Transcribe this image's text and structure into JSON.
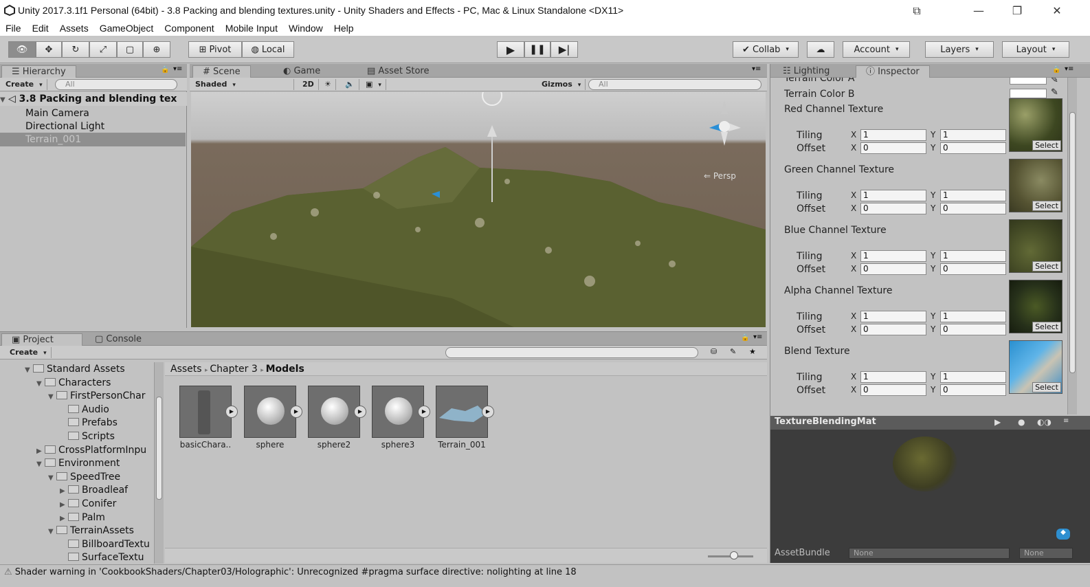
{
  "window": {
    "title": "Unity 2017.3.1f1 Personal (64bit) - 3.8 Packing and blending textures.unity - Unity Shaders and Effects - PC, Mac & Linux Standalone <DX11>"
  },
  "menu": [
    "File",
    "Edit",
    "Assets",
    "GameObject",
    "Component",
    "Mobile Input",
    "Window",
    "Help"
  ],
  "toolbar": {
    "pivot": "Pivot",
    "local": "Local",
    "collab": "Collab",
    "account": "Account",
    "layers": "Layers",
    "layout": "Layout"
  },
  "hierarchy": {
    "tab": "Hierarchy",
    "create": "Create",
    "search_placeholder": "All",
    "scene": "3.8 Packing and blending tex",
    "items": [
      "Main Camera",
      "Directional Light",
      "Terrain_001"
    ]
  },
  "scene": {
    "tabs": [
      "Scene",
      "Game",
      "Asset Store"
    ],
    "shading": "Shaded",
    "mode2d": "2D",
    "gizmos": "Gizmos",
    "search_placeholder": "All",
    "persp": "Persp"
  },
  "inspector": {
    "tabs": [
      "Lighting",
      "Inspector"
    ],
    "color_a": "Terrain Color A",
    "color_b": "Terrain Color B",
    "tiling_label": "Tiling",
    "offset_label": "Offset",
    "x": "X",
    "y": "Y",
    "select": "Select",
    "textures": [
      {
        "name": "Red Channel Texture",
        "tiling_x": "1",
        "tiling_y": "1",
        "offset_x": "0",
        "offset_y": "0"
      },
      {
        "name": "Green Channel Texture",
        "tiling_x": "1",
        "tiling_y": "1",
        "offset_x": "0",
        "offset_y": "0"
      },
      {
        "name": "Blue Channel Texture",
        "tiling_x": "1",
        "tiling_y": "1",
        "offset_x": "0",
        "offset_y": "0"
      },
      {
        "name": "Alpha Channel Texture",
        "tiling_x": "1",
        "tiling_y": "1",
        "offset_x": "0",
        "offset_y": "0"
      },
      {
        "name": "Blend Texture",
        "tiling_x": "1",
        "tiling_y": "1",
        "offset_x": "0",
        "offset_y": "0"
      }
    ],
    "preview_title": "TextureBlendingMat",
    "assetbundle": "AssetBundle",
    "none1": "None",
    "none2": "None"
  },
  "project": {
    "tabs": [
      "Project",
      "Console"
    ],
    "create": "Create",
    "tree": [
      {
        "label": "Standard Assets",
        "depth": 0,
        "open": true
      },
      {
        "label": "Characters",
        "depth": 1,
        "open": true
      },
      {
        "label": "FirstPersonChar",
        "depth": 2,
        "open": true
      },
      {
        "label": "Audio",
        "depth": 3,
        "open": null
      },
      {
        "label": "Prefabs",
        "depth": 3,
        "open": null
      },
      {
        "label": "Scripts",
        "depth": 3,
        "open": null
      },
      {
        "label": "CrossPlatformInpu",
        "depth": 1,
        "open": false
      },
      {
        "label": "Environment",
        "depth": 1,
        "open": true
      },
      {
        "label": "SpeedTree",
        "depth": 2,
        "open": true
      },
      {
        "label": "Broadleaf",
        "depth": 3,
        "open": false
      },
      {
        "label": "Conifer",
        "depth": 3,
        "open": false
      },
      {
        "label": "Palm",
        "depth": 3,
        "open": false
      },
      {
        "label": "TerrainAssets",
        "depth": 2,
        "open": true
      },
      {
        "label": "BillboardTextu",
        "depth": 3,
        "open": null
      },
      {
        "label": "SurfaceTextu",
        "depth": 3,
        "open": null
      }
    ],
    "breadcrumb": [
      "Assets",
      "Chapter 3",
      "Models"
    ],
    "assets": [
      "basicChara..",
      "sphere",
      "sphere2",
      "sphere3",
      "Terrain_001"
    ]
  },
  "status": {
    "message": "Shader warning in 'CookbookShaders/Chapter03/Holographic': Unrecognized #pragma surface directive: nolighting at line 18"
  }
}
